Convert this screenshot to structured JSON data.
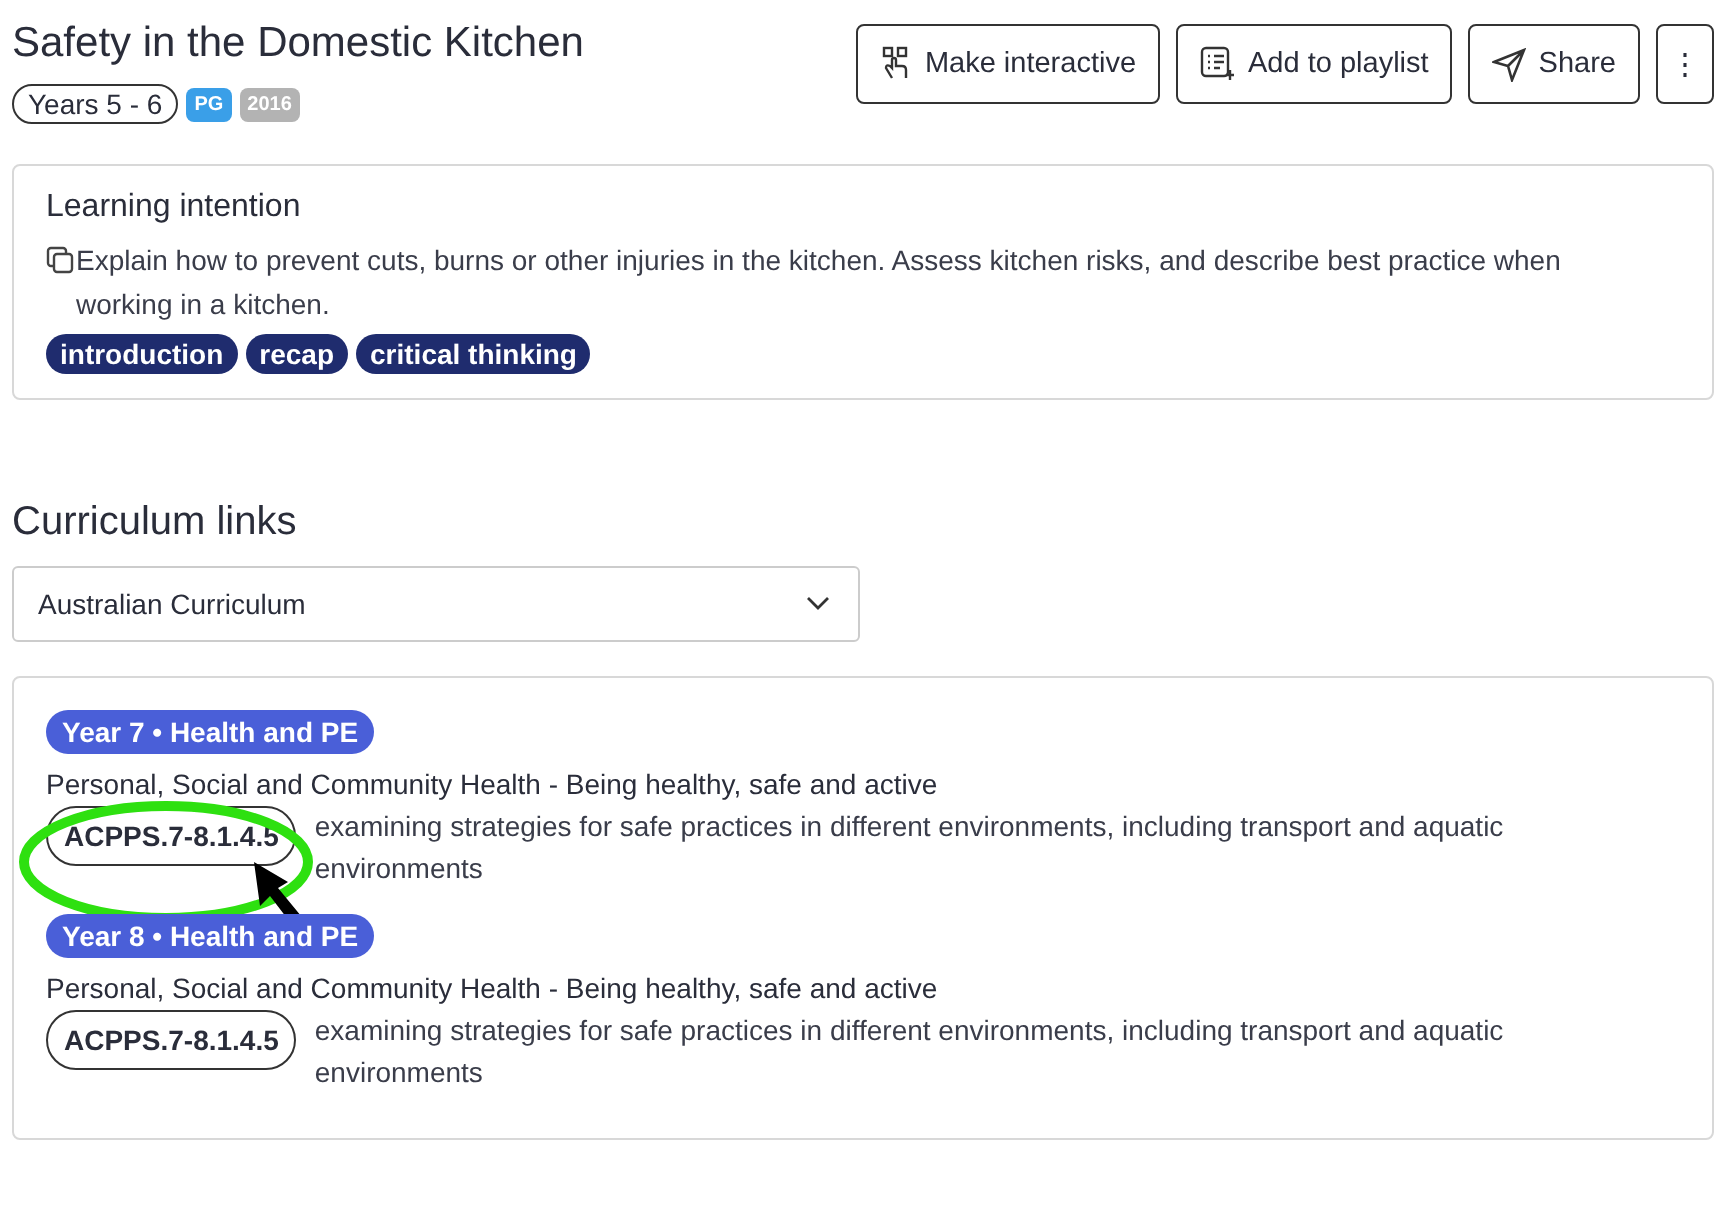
{
  "title": "Safety in the Domestic Kitchen",
  "badges": [
    {
      "kind": "outline",
      "text": "Years 5 - 6"
    },
    {
      "kind": "rating",
      "text": "PG"
    },
    {
      "kind": "year",
      "text": "2016"
    }
  ],
  "actions": [
    {
      "kind": "interactive",
      "label": "Make interactive"
    },
    {
      "kind": "playlist",
      "label": "Add to playlist"
    },
    {
      "kind": "share",
      "label": "Share"
    },
    {
      "kind": "more",
      "label": "⋮"
    }
  ],
  "learning_intention": {
    "heading": "Learning intention",
    "text": "Explain how to prevent cuts, burns or other injuries in the kitchen. Assess kitchen risks, and describe best practice when working in a kitchen.",
    "tags": [
      "introduction",
      "recap",
      "critical thinking"
    ]
  },
  "curriculum": {
    "heading": "Curriculum links",
    "dropdown": "Australian Curriculum",
    "links": [
      {
        "year": "Year 7 • Health and PE",
        "strand": "Personal, Social and Community Health - Being healthy, safe and active",
        "code": "ACPPS.7-8.1.4.5",
        "description": "examining strategies for safe practices in different environments, including transport and aquatic environments",
        "highlighted": true
      },
      {
        "year": "Year 8 • Health and PE",
        "strand": "Personal, Social and Community Health - Being healthy, safe and active",
        "code": "ACPPS.7-8.1.4.5",
        "description": "examining strategies for safe practices in different environments, including transport and aquatic environments",
        "highlighted": false
      }
    ]
  }
}
